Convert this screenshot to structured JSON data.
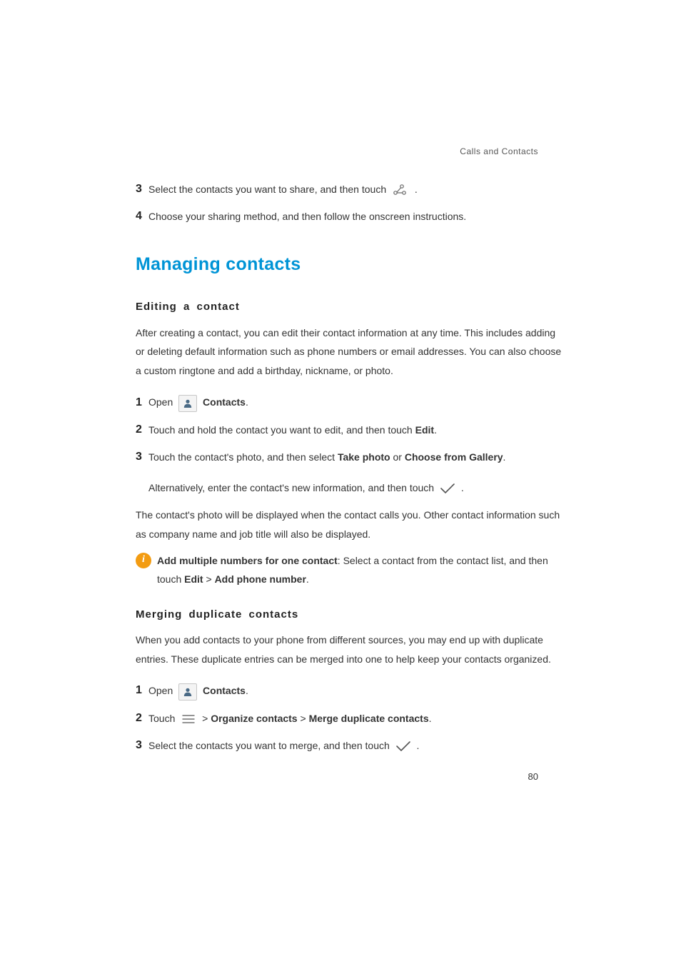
{
  "breadcrumb": "Calls and Contacts",
  "page_number": "80",
  "top_steps": {
    "s3": {
      "num": "3",
      "text_a": "Select the contacts you want to share, and then touch ",
      "text_b": "."
    },
    "s4": {
      "num": "4",
      "text": "Choose your sharing method, and then follow the onscreen instructions."
    }
  },
  "section_title": "Managing contacts",
  "editing": {
    "heading": "Editing a contact",
    "intro": "After creating a contact, you can edit their contact information at any time. This includes adding or deleting default information such as phone numbers or email addresses. You can also choose a custom ringtone and add a birthday, nickname, or photo.",
    "s1": {
      "num": "1",
      "open": "Open ",
      "contacts": "Contacts",
      "dot": "."
    },
    "s2": {
      "num": "2",
      "a": "Touch and hold the contact you want to edit, and then touch ",
      "b": "Edit",
      "c": "."
    },
    "s3": {
      "num": "3",
      "a": "Touch the contact's photo, and then select ",
      "b": "Take photo",
      "c": " or ",
      "d": "Choose from Gallery",
      "e": "."
    },
    "s3_alt": {
      "a": "Alternatively, enter the contact's new information, and then touch ",
      "b": "."
    },
    "post": "The contact's photo will be displayed when the contact calls you. Other contact information such as company name and job title will also be displayed.",
    "info": {
      "i": "i",
      "lead": "Add multiple numbers for one contact",
      "a": ": Select a contact from the contact list, and then touch ",
      "b": "Edit",
      "c": " > ",
      "d": "Add phone number",
      "e": "."
    }
  },
  "merging": {
    "heading": "Merging duplicate contacts",
    "intro": "When you add contacts to your phone from different sources, you may end up with duplicate entries. These duplicate entries can be merged into one to help keep your contacts organized.",
    "s1": {
      "num": "1",
      "open": "Open ",
      "contacts": "Contacts",
      "dot": "."
    },
    "s2": {
      "num": "2",
      "a": "Touch ",
      "b": " > ",
      "c": "Organize contacts",
      "d": " > ",
      "e": "Merge duplicate contacts",
      "f": "."
    },
    "s3": {
      "num": "3",
      "a": "Select the contacts you want to merge, and then touch ",
      "b": "."
    }
  }
}
